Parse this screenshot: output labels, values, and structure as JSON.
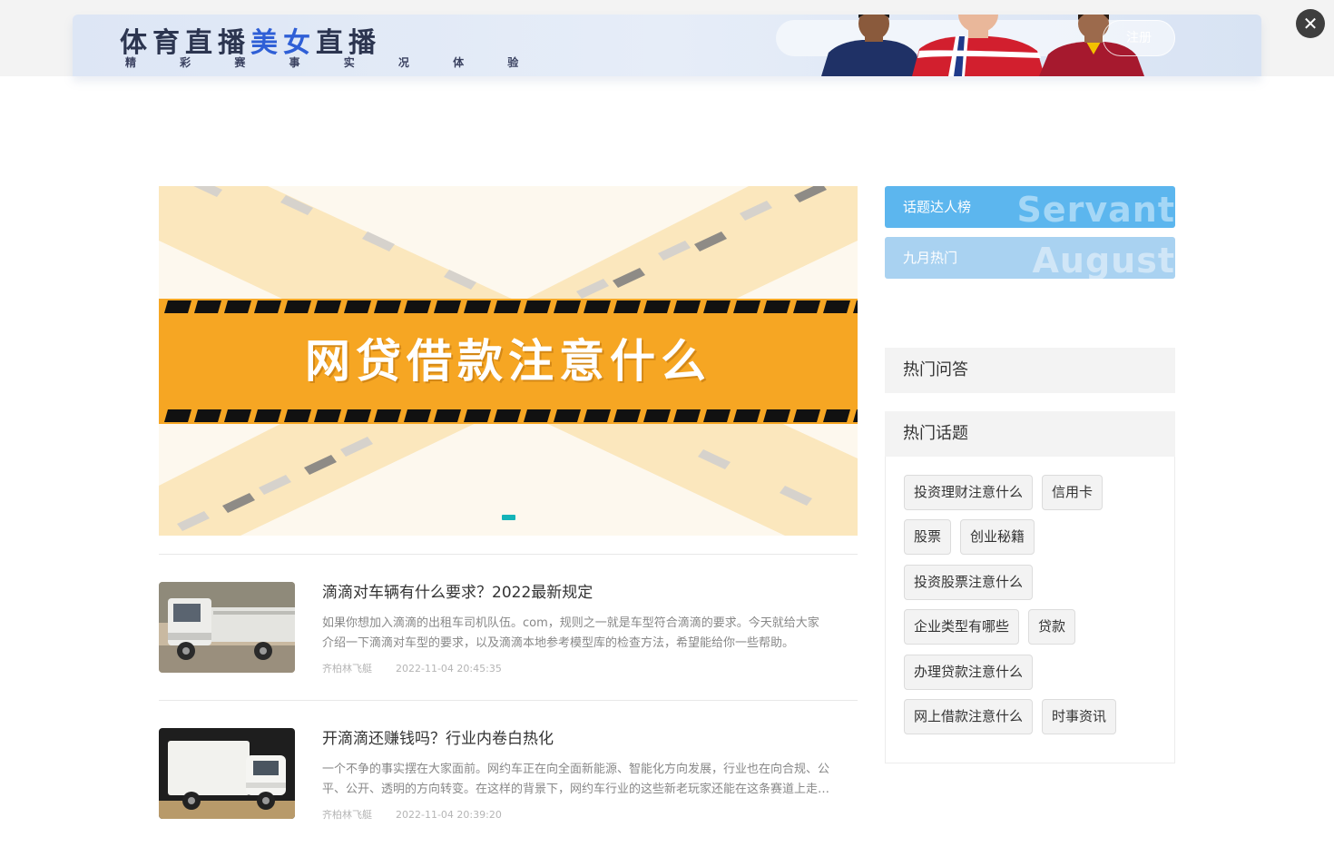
{
  "ad": {
    "title_part1": "体育直播",
    "title_part2": "美女",
    "title_part3": "直播",
    "subtitle": "精 彩 赛 事 实 况 体 验",
    "search_button": "注册",
    "close_symbol": "✕"
  },
  "carousel": {
    "caption": "网贷借款注意什么",
    "colors": {
      "band": "#f6a623",
      "stripe_light": "#fbe3b4",
      "dot": "#14b4b8"
    }
  },
  "articles": [
    {
      "title": "滴滴对车辆有什么要求？2022最新规定",
      "summary": "如果你想加入滴滴的出租车司机队伍。com，规则之一就是车型符合滴滴的要求。今天就给大家介绍一下滴滴对车型的要求，以及滴滴本地参考模型库的检查方法，希望能给你一些帮助。",
      "author": "齐柏林飞艇",
      "time": "2022-11-04 20:45:35"
    },
    {
      "title": "开滴滴还赚钱吗？行业内卷白热化",
      "summary": "一个不争的事实摆在大家面前。网约车正在向全面新能源、智能化方向发展，行业也在向合规、公平、公开、透明的方向转变。在这样的背景下，网约车行业的这些新老玩家还能在这条赛道上走多远？",
      "author": "齐柏林飞艇",
      "time": "2022-11-04 20:39:20"
    }
  ],
  "sidebar": {
    "tabs": [
      {
        "label": "话题达人榜",
        "watermark": "Servant"
      },
      {
        "label": "九月热门",
        "watermark": "August"
      }
    ],
    "hot_qa_title": "热门问答",
    "hot_topics_title": "热门话题",
    "topics": [
      "投资理财注意什么",
      "信用卡",
      "股票",
      "创业秘籍",
      "投资股票注意什么",
      "企业类型有哪些",
      "贷款",
      "办理贷款注意什么",
      "网上借款注意什么",
      "时事资讯"
    ]
  }
}
